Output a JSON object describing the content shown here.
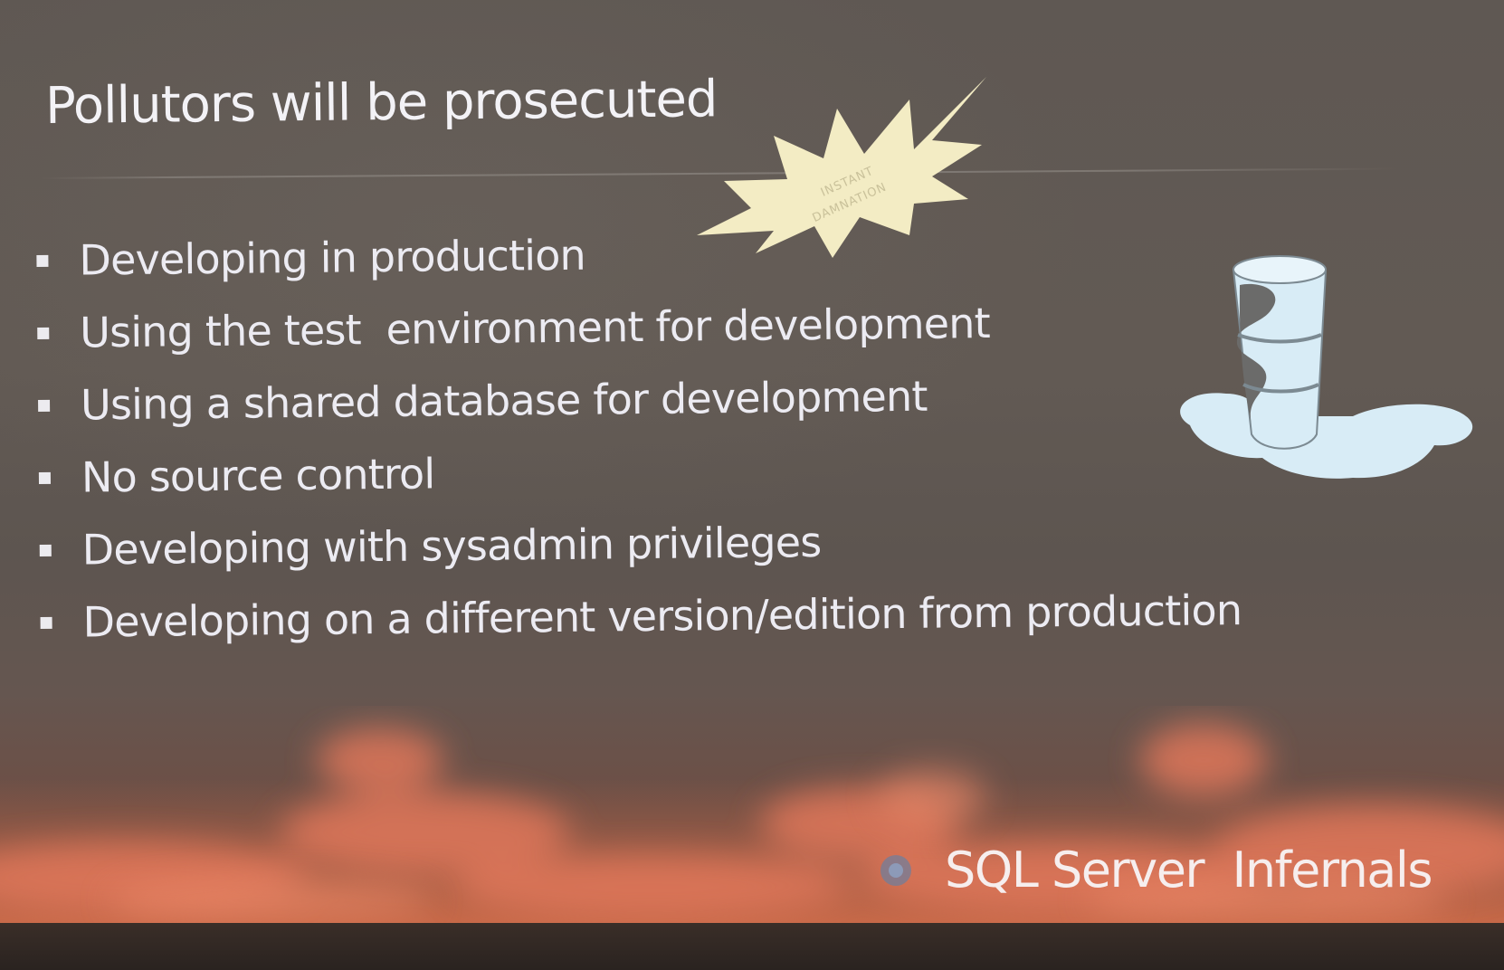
{
  "slide": {
    "title": "Pollutors will be prosecuted",
    "bullets": [
      "Developing in production",
      "Using the test  environment for development",
      "Using a shared database for development",
      "No source control",
      "Developing with sysadmin privileges",
      "Developing on a different version/edition from production"
    ],
    "burst": {
      "line1": "INSTANT",
      "line2": "DAMNATION"
    },
    "brand": "SQL Server  Infernals",
    "colors": {
      "text": "#ecebf2",
      "burst": "#f3ecc4",
      "barrel": "#d8ecf6"
    },
    "icons": [
      "starburst-icon",
      "spilled-barrel-icon",
      "brand-logo-icon"
    ]
  }
}
